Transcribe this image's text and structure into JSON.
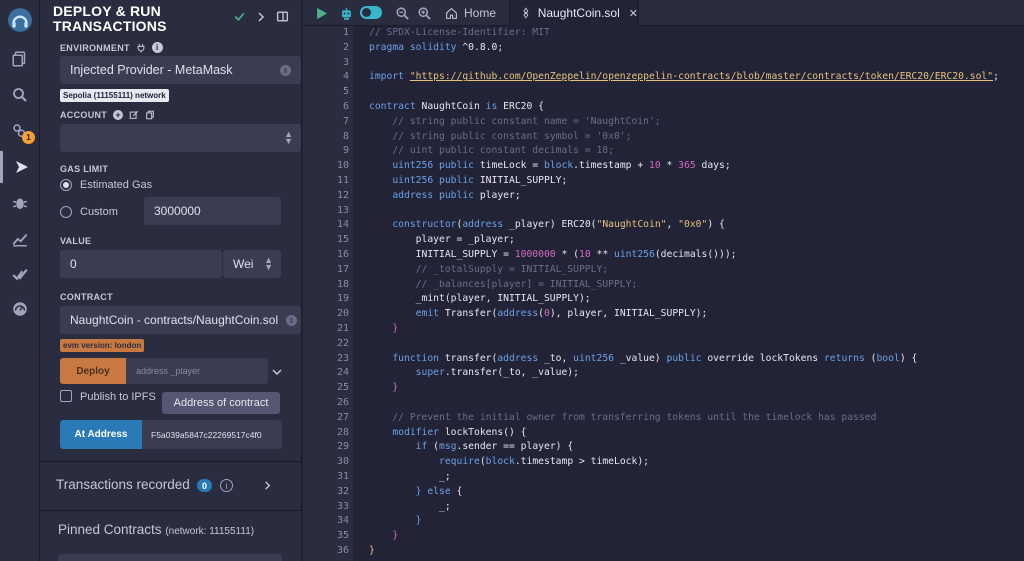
{
  "panel": {
    "title_line1": "DEPLOY & RUN",
    "title_line2": "TRANSACTIONS",
    "environment_label": "ENVIRONMENT",
    "environment_value": "Injected Provider - MetaMask",
    "network_badge": "Sepolia (11155111) network",
    "account_label": "ACCOUNT",
    "account_value": "",
    "gas_limit_label": "GAS LIMIT",
    "estimated_gas_label": "Estimated Gas",
    "custom_label": "Custom",
    "custom_gas_value": "3000000",
    "value_label": "VALUE",
    "value_amount": "0",
    "value_unit": "Wei",
    "contract_label": "CONTRACT",
    "contract_value": "NaughtCoin - contracts/NaughtCoin.sol",
    "evm_badge": "evm version: london",
    "deploy_button": "Deploy",
    "deploy_placeholder": "address _player",
    "publish_ipfs_label": "Publish to IPFS",
    "tooltip": "Address of contract",
    "at_address_button": "At Address",
    "at_address_value": "F5a039a5847c22269517c4f0",
    "transactions_label": "Transactions recorded",
    "transactions_count": "0",
    "pinned_label": "Pinned Contracts",
    "pinned_network": "(network: 11155111)"
  },
  "rail": {
    "badge_count": "1"
  },
  "topbar": {
    "home_tab": "Home",
    "file_tab": "NaughtCoin.sol",
    "close_glyph": "✕"
  },
  "editor": {
    "line_numbers": [
      "1",
      "2",
      "3",
      "4",
      "5",
      "6",
      "7",
      "8",
      "9",
      "10",
      "11",
      "12",
      "13",
      "14",
      "15",
      "16",
      "17",
      "18",
      "19",
      "20",
      "21",
      "22",
      "23",
      "24",
      "25",
      "26",
      "27",
      "28",
      "29",
      "30",
      "31",
      "32",
      "33",
      "34",
      "35",
      "36"
    ],
    "lines": [
      [
        [
          "c",
          "// SPDX-License-Identifier: MIT"
        ]
      ],
      [
        [
          "k",
          "pragma"
        ],
        [
          "p",
          " "
        ],
        [
          "k",
          "solidity"
        ],
        [
          "p",
          " ^0.8.0;"
        ]
      ],
      [],
      [
        [
          "k",
          "import"
        ],
        [
          "p",
          " "
        ],
        [
          "u",
          "\"https://github.com/OpenZeppelin/openzeppelin-contracts/blob/master/contracts/token/ERC20/ERC20.sol\""
        ],
        [
          "p",
          ";"
        ]
      ],
      [],
      [
        [
          "k",
          "contract"
        ],
        [
          "p",
          " NaughtCoin "
        ],
        [
          "k",
          "is"
        ],
        [
          "p",
          " ERC20 {"
        ]
      ],
      [
        [
          "c",
          "    // string public constant name = 'NaughtCoin';"
        ]
      ],
      [
        [
          "c",
          "    // string public constant symbol = '0x0';"
        ]
      ],
      [
        [
          "c",
          "    // uint public constant decimals = 18;"
        ]
      ],
      [
        [
          "t",
          "    uint256"
        ],
        [
          "p",
          " "
        ],
        [
          "k",
          "public"
        ],
        [
          "p",
          " timeLock = "
        ],
        [
          "t",
          "block"
        ],
        [
          "p",
          ".timestamp + "
        ],
        [
          "n",
          "10"
        ],
        [
          "p",
          " * "
        ],
        [
          "n",
          "365"
        ],
        [
          "p",
          " days;"
        ]
      ],
      [
        [
          "t",
          "    uint256"
        ],
        [
          "p",
          " "
        ],
        [
          "k",
          "public"
        ],
        [
          "p",
          " INITIAL_SUPPLY;"
        ]
      ],
      [
        [
          "t",
          "    address"
        ],
        [
          "p",
          " "
        ],
        [
          "k",
          "public"
        ],
        [
          "p",
          " player;"
        ]
      ],
      [],
      [
        [
          "k",
          "    constructor"
        ],
        [
          "p",
          "("
        ],
        [
          "t",
          "address"
        ],
        [
          "p",
          " _player) ERC20("
        ],
        [
          "s",
          "\"NaughtCoin\""
        ],
        [
          "p",
          ", "
        ],
        [
          "s",
          "\"0x0\""
        ],
        [
          "p",
          ") {"
        ]
      ],
      [
        [
          "p",
          "        player = _player;"
        ]
      ],
      [
        [
          "p",
          "        INITIAL_SUPPLY = "
        ],
        [
          "n",
          "1000000"
        ],
        [
          "p",
          " * ("
        ],
        [
          "n",
          "10"
        ],
        [
          "p",
          " ** "
        ],
        [
          "t",
          "uint256"
        ],
        [
          "p",
          "(decimals()));"
        ]
      ],
      [
        [
          "c",
          "        // _totalSupply = INITIAL_SUPPLY;"
        ]
      ],
      [
        [
          "c",
          "        // _balances[player] = INITIAL_SUPPLY;"
        ]
      ],
      [
        [
          "p",
          "        _mint(player, INITIAL_SUPPLY);"
        ]
      ],
      [
        [
          "k",
          "        emit"
        ],
        [
          "p",
          " Transfer("
        ],
        [
          "t",
          "address"
        ],
        [
          "p",
          "("
        ],
        [
          "n",
          "0"
        ],
        [
          "p",
          "), player, INITIAL_SUPPLY);"
        ]
      ],
      [
        [
          "n",
          "    }"
        ]
      ],
      [],
      [
        [
          "k",
          "    function"
        ],
        [
          "p",
          " transfer("
        ],
        [
          "t",
          "address"
        ],
        [
          "p",
          " _to, "
        ],
        [
          "t",
          "uint256"
        ],
        [
          "p",
          " _value) "
        ],
        [
          "k",
          "public"
        ],
        [
          "p",
          " override lockTokens "
        ],
        [
          "k",
          "returns"
        ],
        [
          "p",
          " ("
        ],
        [
          "t",
          "bool"
        ],
        [
          "p",
          ") {"
        ]
      ],
      [
        [
          "t",
          "        super"
        ],
        [
          "p",
          ".transfer(_to, _value);"
        ]
      ],
      [
        [
          "n",
          "    }"
        ]
      ],
      [],
      [
        [
          "c",
          "    // Prevent the initial owner from transferring tokens until the timelock has passed"
        ]
      ],
      [
        [
          "k",
          "    modifier"
        ],
        [
          "p",
          " lockTokens() {"
        ]
      ],
      [
        [
          "k",
          "        if"
        ],
        [
          "p",
          " ("
        ],
        [
          "t",
          "msg"
        ],
        [
          "p",
          ".sender == player) {"
        ]
      ],
      [
        [
          "k",
          "            require"
        ],
        [
          "p",
          "("
        ],
        [
          "t",
          "block"
        ],
        [
          "p",
          ".timestamp > timeLock);"
        ]
      ],
      [
        [
          "p",
          "            _;"
        ]
      ],
      [
        [
          "k",
          "        }"
        ],
        [
          "p",
          " "
        ],
        [
          "k",
          "else"
        ],
        [
          "p",
          " {"
        ]
      ],
      [
        [
          "p",
          "            _;"
        ]
      ],
      [
        [
          "k",
          "        }"
        ]
      ],
      [
        [
          "n",
          "    }"
        ]
      ],
      [
        [
          "s",
          "}"
        ]
      ]
    ]
  },
  "colors": {
    "accent": "#2a7ab5",
    "deploy": "#c87941",
    "bg": "#222336",
    "panel": "#2a2c3f"
  }
}
